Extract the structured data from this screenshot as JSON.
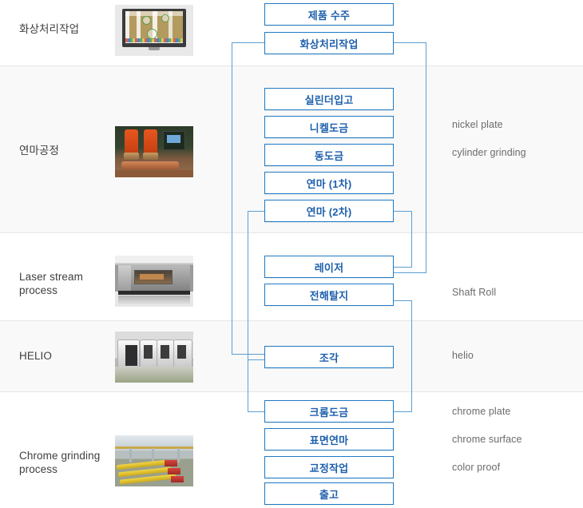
{
  "diagram": {
    "title": "Production process flow",
    "accent_box_border": "#2079c4",
    "accent_box_text": "#1d5fad",
    "connector_color": "#5a9fd4",
    "row_alt_background": "#f9f9f9",
    "row_divider": "#e6e6e6"
  },
  "rows": [
    {
      "label": "화상처리작업",
      "thumb": "monitor-image-processing-photo"
    },
    {
      "label": "연마공정",
      "thumb": "orange-grinding-machine-photo"
    },
    {
      "label": "Laser stream\nprocess",
      "label_line1": "Laser stream",
      "label_line2": "process",
      "thumb": "laser-machine-photo"
    },
    {
      "label": "HELIO",
      "thumb": "helio-engraving-machines-photo"
    },
    {
      "label": "Chrome grinding\nprocess",
      "label_line1": "Chrome grinding",
      "label_line2": "process",
      "thumb": "yellow-conveyor-factory-photo"
    }
  ],
  "steps": [
    {
      "id": "step-1",
      "label": "제품 수주"
    },
    {
      "id": "step-2",
      "label": "화상처리작업"
    },
    {
      "id": "step-3",
      "label": "실린더입고"
    },
    {
      "id": "step-4",
      "label": "니켈도금"
    },
    {
      "id": "step-5",
      "label": "동도금"
    },
    {
      "id": "step-6",
      "label": "연마 (1차)"
    },
    {
      "id": "step-7",
      "label": "연마 (2차)"
    },
    {
      "id": "step-8",
      "label": "레이저"
    },
    {
      "id": "step-9",
      "label": "전해탈지"
    },
    {
      "id": "step-10",
      "label": "조각"
    },
    {
      "id": "step-11",
      "label": "크롬도금"
    },
    {
      "id": "step-12",
      "label": "표면연마"
    },
    {
      "id": "step-13",
      "label": "교정작업"
    },
    {
      "id": "step-14",
      "label": "출고"
    }
  ],
  "notes": [
    {
      "id": "note-nickel-plate",
      "label": "nickel plate"
    },
    {
      "id": "note-cylinder-grind",
      "label": "cylinder grinding"
    },
    {
      "id": "note-shaft-roll",
      "label": "Shaft Roll"
    },
    {
      "id": "note-helio",
      "label": "helio"
    },
    {
      "id": "note-chrome-plate",
      "label": "chrome plate"
    },
    {
      "id": "note-chrome-surface",
      "label": "chrome surface"
    },
    {
      "id": "note-color-proof",
      "label": "color proof"
    }
  ]
}
